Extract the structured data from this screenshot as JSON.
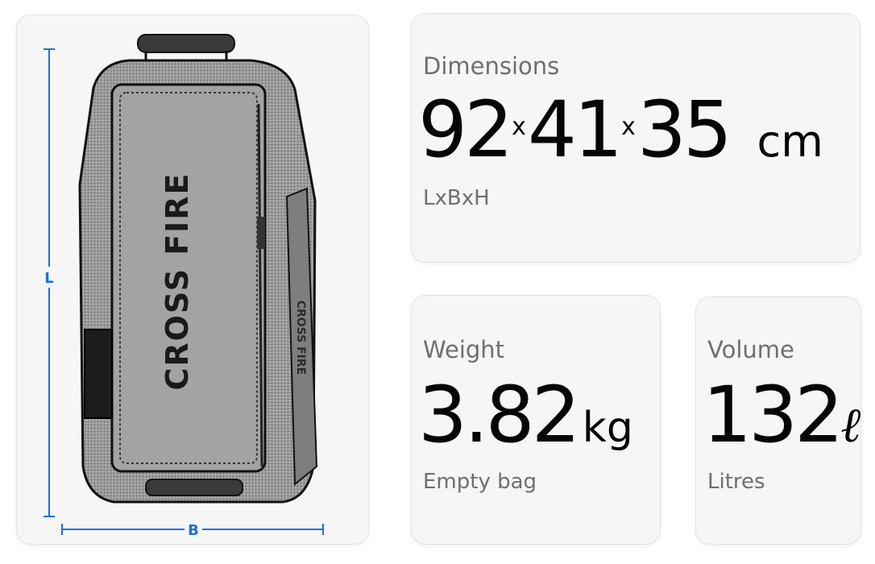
{
  "product": {
    "brand_text": "CROSS FIRE",
    "measure": {
      "length_label": "L",
      "width_label": "B"
    }
  },
  "dimensions": {
    "label": "Dimensions",
    "l": "92",
    "b": "41",
    "h": "35",
    "sep": "x",
    "unit": "cm",
    "caption": "LxBxH"
  },
  "weight": {
    "label": "Weight",
    "value": "3.82",
    "unit": "kg",
    "caption": "Empty bag"
  },
  "volume": {
    "label": "Volume",
    "value": "132",
    "unit": "ℓ",
    "caption": "Litres"
  },
  "colors": {
    "accent": "#1e6fd9",
    "card_bg": "#f6f6f6",
    "muted": "#6f6f6f"
  }
}
